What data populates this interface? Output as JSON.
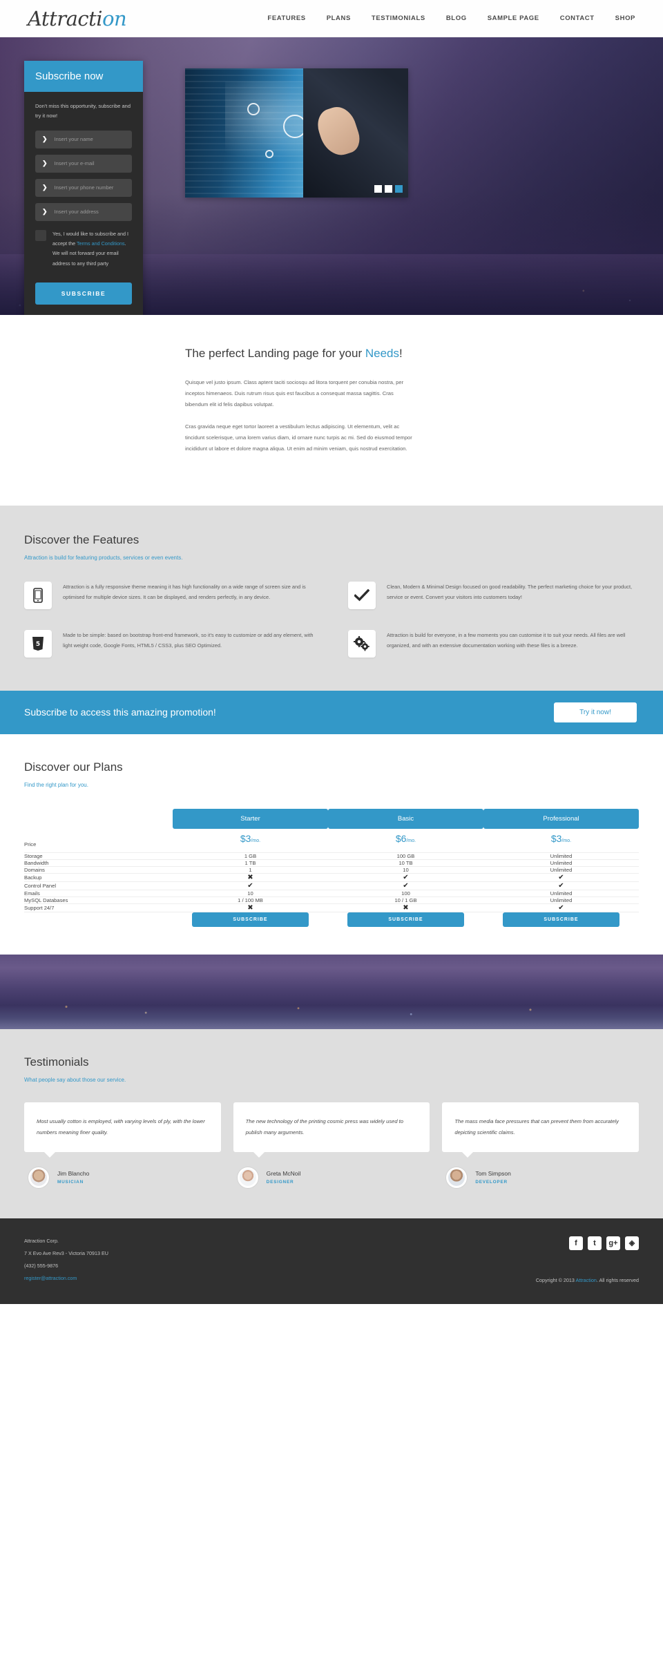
{
  "header": {
    "logo_main": "Attracti",
    "logo_accent": "on",
    "nav": [
      {
        "label": "FEATURES"
      },
      {
        "label": "PLANS"
      },
      {
        "label": "TESTIMONIALS"
      },
      {
        "label": "BLOG"
      },
      {
        "label": "SAMPLE PAGE"
      },
      {
        "label": "CONTACT"
      },
      {
        "label": "SHOP"
      }
    ]
  },
  "subscribe_card": {
    "title": "Subscribe now",
    "intro": "Don't miss this opportunity, subscribe and try it now!",
    "fields": [
      {
        "placeholder": "Insert your name",
        "value": ""
      },
      {
        "placeholder": "Insert your e-mail",
        "value": ""
      },
      {
        "placeholder": "Insert your phone number",
        "value": ""
      },
      {
        "placeholder": "Insert your address",
        "value": ""
      }
    ],
    "terms_pre": "Yes, I would like to subscribe and I accept the ",
    "terms_link": "Terms and Conditions",
    "terms_post": ". We will not forward your email address to any third party",
    "button": "SUBSCRIBE"
  },
  "slider": {
    "dots": [
      "1",
      "2",
      "3"
    ],
    "active_dot": 3
  },
  "intro": {
    "heading_pre": "The perfect Landing page for your ",
    "heading_accent": "Needs",
    "heading_post": "!",
    "p1": "Quisque vel justo ipsum. Class aptent taciti sociosqu ad litora torquent per conubia nostra, per inceptos himenaeos. Duis rutrum risus quis est faucibus a consequat massa sagittis. Cras bibendum elit id felis dapibus volutpat.",
    "p2": "Cras gravida neque eget tortor laoreet a vestibulum lectus adipiscing. Ut elementum, velit ac tincidunt scelerisque, urna lorem varius diam, id ornare nunc turpis ac mi. Sed do eiusmod tempor incididunt ut labore et dolore magna aliqua. Ut enim ad minim veniam, quis nostrud exercitation."
  },
  "features": {
    "title": "Discover the Features",
    "subtitle": "Attraction is build for featuring products, services or even events.",
    "items": [
      {
        "icon": "mobile-icon",
        "text": "Attraction is a fully responsive theme meaning it has high functionality on a wide range of screen size and is optimised for multiple device sizes. It can be displayed, and renders perfectly, in any device."
      },
      {
        "icon": "check-icon",
        "text": "Clean, Modern & Minimal Design focused on good readability. The perfect marketing choice for your product, service or event. Convert your visitors into customers today!"
      },
      {
        "icon": "html5-icon",
        "text": "Made to be simple: based on bootstrap front-end framework, so it's easy to customize or add any element, with light weight code, Google Fonts, HTML5 / CSS3, plus SEO Optimized."
      },
      {
        "icon": "gears-icon",
        "text": "Attraction is build for everyone, in a few moments you can customise it to suit your needs. All files are well organized, and with an extensive documentation working with these files is a breeze."
      }
    ]
  },
  "promo": {
    "text": "Subscribe to access this amazing promotion!",
    "button": "Try it now!"
  },
  "plans": {
    "title": "Discover our Plans",
    "subtitle": "Find the right plan for you.",
    "columns": [
      "Starter",
      "Basic",
      "Professional"
    ],
    "rows": [
      {
        "label": "Price",
        "values": [
          "$3",
          "$6",
          "$3"
        ],
        "suffix": "/mo.",
        "type": "price"
      },
      {
        "label": "Storage",
        "values": [
          "1 GB",
          "100 GB",
          "Unlimited"
        ],
        "type": "text"
      },
      {
        "label": "Bandwidth",
        "values": [
          "1 TB",
          "10 TB",
          "Unlimited"
        ],
        "type": "text"
      },
      {
        "label": "Domains",
        "values": [
          "1",
          "10",
          "Unlimited"
        ],
        "type": "text"
      },
      {
        "label": "Backup",
        "values": [
          "✖",
          "✔",
          "✔"
        ],
        "type": "mark"
      },
      {
        "label": "Control Panel",
        "values": [
          "✔",
          "✔",
          "✔"
        ],
        "type": "mark"
      },
      {
        "label": "Emails",
        "values": [
          "10",
          "100",
          "Unlimited"
        ],
        "type": "text"
      },
      {
        "label": "MySQL Databases",
        "values": [
          "1 / 100 MB",
          "10 / 1 GB",
          "Unlimited"
        ],
        "type": "text"
      },
      {
        "label": "Support 24/7",
        "values": [
          "✖",
          "✖",
          "✔"
        ],
        "type": "mark"
      }
    ],
    "subscribe_label": "SUBSCRIBE"
  },
  "testimonials": {
    "title": "Testimonials",
    "subtitle": "What people say about those our service.",
    "items": [
      {
        "quote": "Most usually cotton is employed, with varying levels of ply, with the lower numbers meaning finer quality.",
        "name": "Jim Blancho",
        "role": "MUSICIAN"
      },
      {
        "quote": "The new technology of the printing cosmic press was widely used to publish many arguments.",
        "name": "Greta McNoil",
        "role": "DESIGNER"
      },
      {
        "quote": "The mass media face pressures that can prevent them from accurately depicting scientific claims.",
        "name": "Tom Simpson",
        "role": "DEVELOPER"
      }
    ]
  },
  "footer": {
    "company": "Attraction Corp.",
    "address": "7 X Evo Ave Rev3 - Victoria 70913 EU",
    "phone": "(432) 555-9876",
    "email": "register@attraction.com",
    "socials": [
      {
        "name": "facebook-icon",
        "glyph": "f"
      },
      {
        "name": "twitter-icon",
        "glyph": "t"
      },
      {
        "name": "google-plus-icon",
        "glyph": "g+"
      },
      {
        "name": "dribbble-icon",
        "glyph": "◈"
      }
    ],
    "copyright_pre": "Copyright © 2013 ",
    "copyright_link": "Attraction",
    "copyright_post": ". All rights reserved"
  },
  "colors": {
    "accent": "#3398c8",
    "dark": "#2b2b2b",
    "footer": "#303030",
    "section_gray": "#dedede"
  }
}
